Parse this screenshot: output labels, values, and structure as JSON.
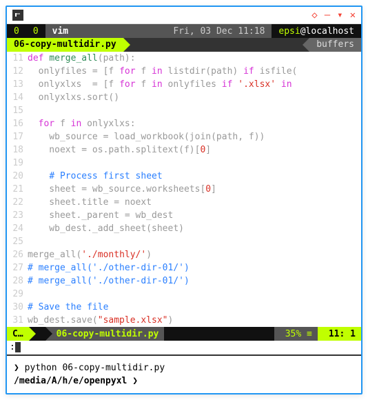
{
  "topbar": {
    "seg1": "0",
    "seg2": "0",
    "app": "vim",
    "date": "Fri, 03 Dec 11:18",
    "user": "epsi",
    "host": "localhost"
  },
  "tab": {
    "active": "06-copy-multidir.py",
    "right": "buffers"
  },
  "lines": [
    {
      "n": "11",
      "html": "<span class='kw'>def</span> <span class='fn'>merge_all</span>(path):"
    },
    {
      "n": "12",
      "html": "  onlyfiles = [f <span class='kw'>for</span> f <span class='kw'>in</span> listdir(path) <span class='kw'>if</span> isfile("
    },
    {
      "n": "13",
      "html": "  onlyxlxs  = [f <span class='kw'>for</span> f <span class='kw'>in</span> onlyfiles <span class='kw'>if</span> <span class='str'>'.xlsx'</span> <span class='kw'>in</span>"
    },
    {
      "n": "14",
      "html": "  onlyxlxs.sort()"
    },
    {
      "n": "15",
      "html": ""
    },
    {
      "n": "16",
      "html": "  <span class='kw'>for</span> f <span class='kw'>in</span> onlyxlxs:"
    },
    {
      "n": "17",
      "html": "    wb_source = load_workbook(join(path, f))"
    },
    {
      "n": "18",
      "html": "    noext = os.path.splitext(f)[<span class='num'>0</span>]"
    },
    {
      "n": "19",
      "html": ""
    },
    {
      "n": "20",
      "html": "    <span class='cmt'># Process first sheet</span>"
    },
    {
      "n": "21",
      "html": "    sheet = wb_source.worksheets[<span class='num'>0</span>]"
    },
    {
      "n": "22",
      "html": "    sheet.title = noext"
    },
    {
      "n": "23",
      "html": "    sheet._parent = wb_dest"
    },
    {
      "n": "24",
      "html": "    wb_dest._add_sheet(sheet)"
    },
    {
      "n": "25",
      "html": ""
    },
    {
      "n": "26",
      "html": "merge_all(<span class='str'>'./monthly/'</span>)"
    },
    {
      "n": "27",
      "html": "<span class='cmt'># merge_all('./other-dir-01/')</span>"
    },
    {
      "n": "28",
      "html": "<span class='cmt'># merge_all('./other-dir-01/')</span>"
    },
    {
      "n": "29",
      "html": ""
    },
    {
      "n": "30",
      "html": "<span class='cmt'># Save the file</span>"
    },
    {
      "n": "31",
      "html": "wb_dest.save(<span class='str'>\"sample.xlsx\"</span>)"
    }
  ],
  "status": {
    "mode": "C…",
    "file": "06-copy-multidir.py",
    "pct": "35% ≡",
    "pos": "  11:  1"
  },
  "cmdline": ":",
  "term": {
    "line1_prompt": "❯",
    "line1_cmd": " python 06-copy-multidir.py",
    "line2_path": "/media/A/h/e/openpyxl",
    "line2_prompt": " ❯ "
  }
}
